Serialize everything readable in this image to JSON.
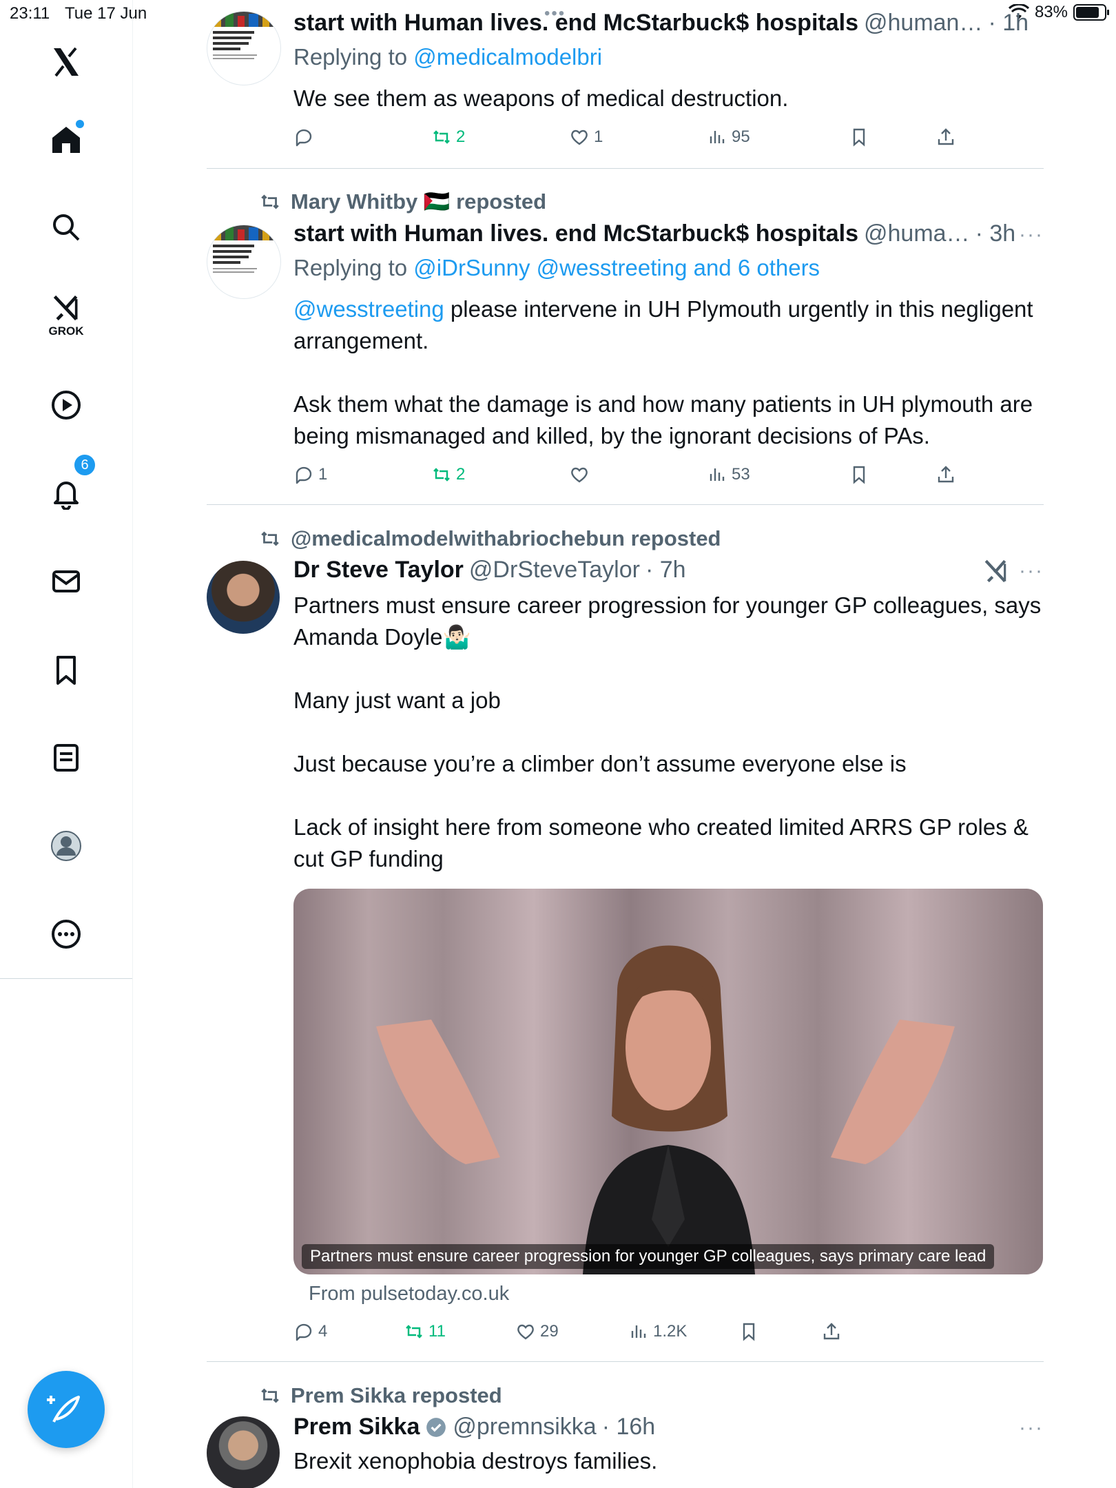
{
  "status_bar": {
    "time": "23:11",
    "date": "Tue 17 Jun",
    "battery": "83%",
    "battery_level": 0.83
  },
  "sidebar": {
    "items": [
      {
        "name": "x-logo",
        "icon": "x-logo"
      },
      {
        "name": "home",
        "icon": "home-icon",
        "dot": true
      },
      {
        "name": "search",
        "icon": "search-icon"
      },
      {
        "name": "grok",
        "icon": "grok-icon",
        "label": "GROK"
      },
      {
        "name": "video",
        "icon": "play-icon"
      },
      {
        "name": "notifications",
        "icon": "bell-icon",
        "badge": "6"
      },
      {
        "name": "messages",
        "icon": "mail-icon"
      },
      {
        "name": "bookmarks",
        "icon": "bookmark-icon"
      },
      {
        "name": "lists",
        "icon": "list-icon"
      },
      {
        "name": "profile",
        "icon": "profile-icon"
      },
      {
        "name": "more",
        "icon": "more-icon"
      }
    ],
    "compose_icon": "compose-icon"
  },
  "tweets": [
    {
      "name": "start with Human lives. end McStarbuck$ hospitals",
      "handle": "@human…",
      "time": "· 1h",
      "reply_to_prefix": "Replying to",
      "reply_to": "@medicalmodelbri",
      "text": "We see them as weapons of medical destruction.",
      "stats": {
        "replies": "",
        "reposts": "2",
        "likes": "1",
        "views": "95"
      }
    },
    {
      "reposted_by": "Mary Whitby 🇵🇸 reposted",
      "name": "start with Human lives. end McStarbuck$ hospitals",
      "handle": "@huma…",
      "time": "· 3h",
      "more": "···",
      "reply_to_prefix": "Replying to",
      "reply_to": "@iDrSunny @wesstreeting and 6 others",
      "mention": "@wesstreeting",
      "text": " please intervene in UH Plymouth urgently in this negligent arrangement.\n\nAsk them what the damage is and how many patients in UH plymouth are being mismanaged and killed, by the ignorant decisions of PAs.",
      "stats": {
        "replies": "1",
        "reposts": "2",
        "likes": "",
        "views": "53"
      }
    },
    {
      "reposted_by": "@medicalmodelwithabriochebun reposted",
      "name": "Dr Steve Taylor",
      "handle": "@DrSteveTaylor",
      "time": "· 7h",
      "more": "···",
      "text": "Partners must ensure career progression for younger GP colleagues, says Amanda Doyle🤷🏻‍♂️\n\nMany just want a job\n\nJust because you’re a climber don’t assume everyone else is\n\nLack of insight here from someone who created limited ARRS GP roles & cut GP funding",
      "card_caption": "Partners must ensure career progression for younger GP colleagues, says primary care lead",
      "card_source": "From pulsetoday.co.uk",
      "stats": {
        "replies": "4",
        "reposts": "11",
        "likes": "29",
        "views": "1.2K"
      }
    },
    {
      "reposted_by": "Prem Sikka reposted",
      "name": "Prem Sikka",
      "handle": "@premnsikka",
      "time": "· 16h",
      "more": "···",
      "text": "Brexit xenophobia destroys families."
    }
  ]
}
